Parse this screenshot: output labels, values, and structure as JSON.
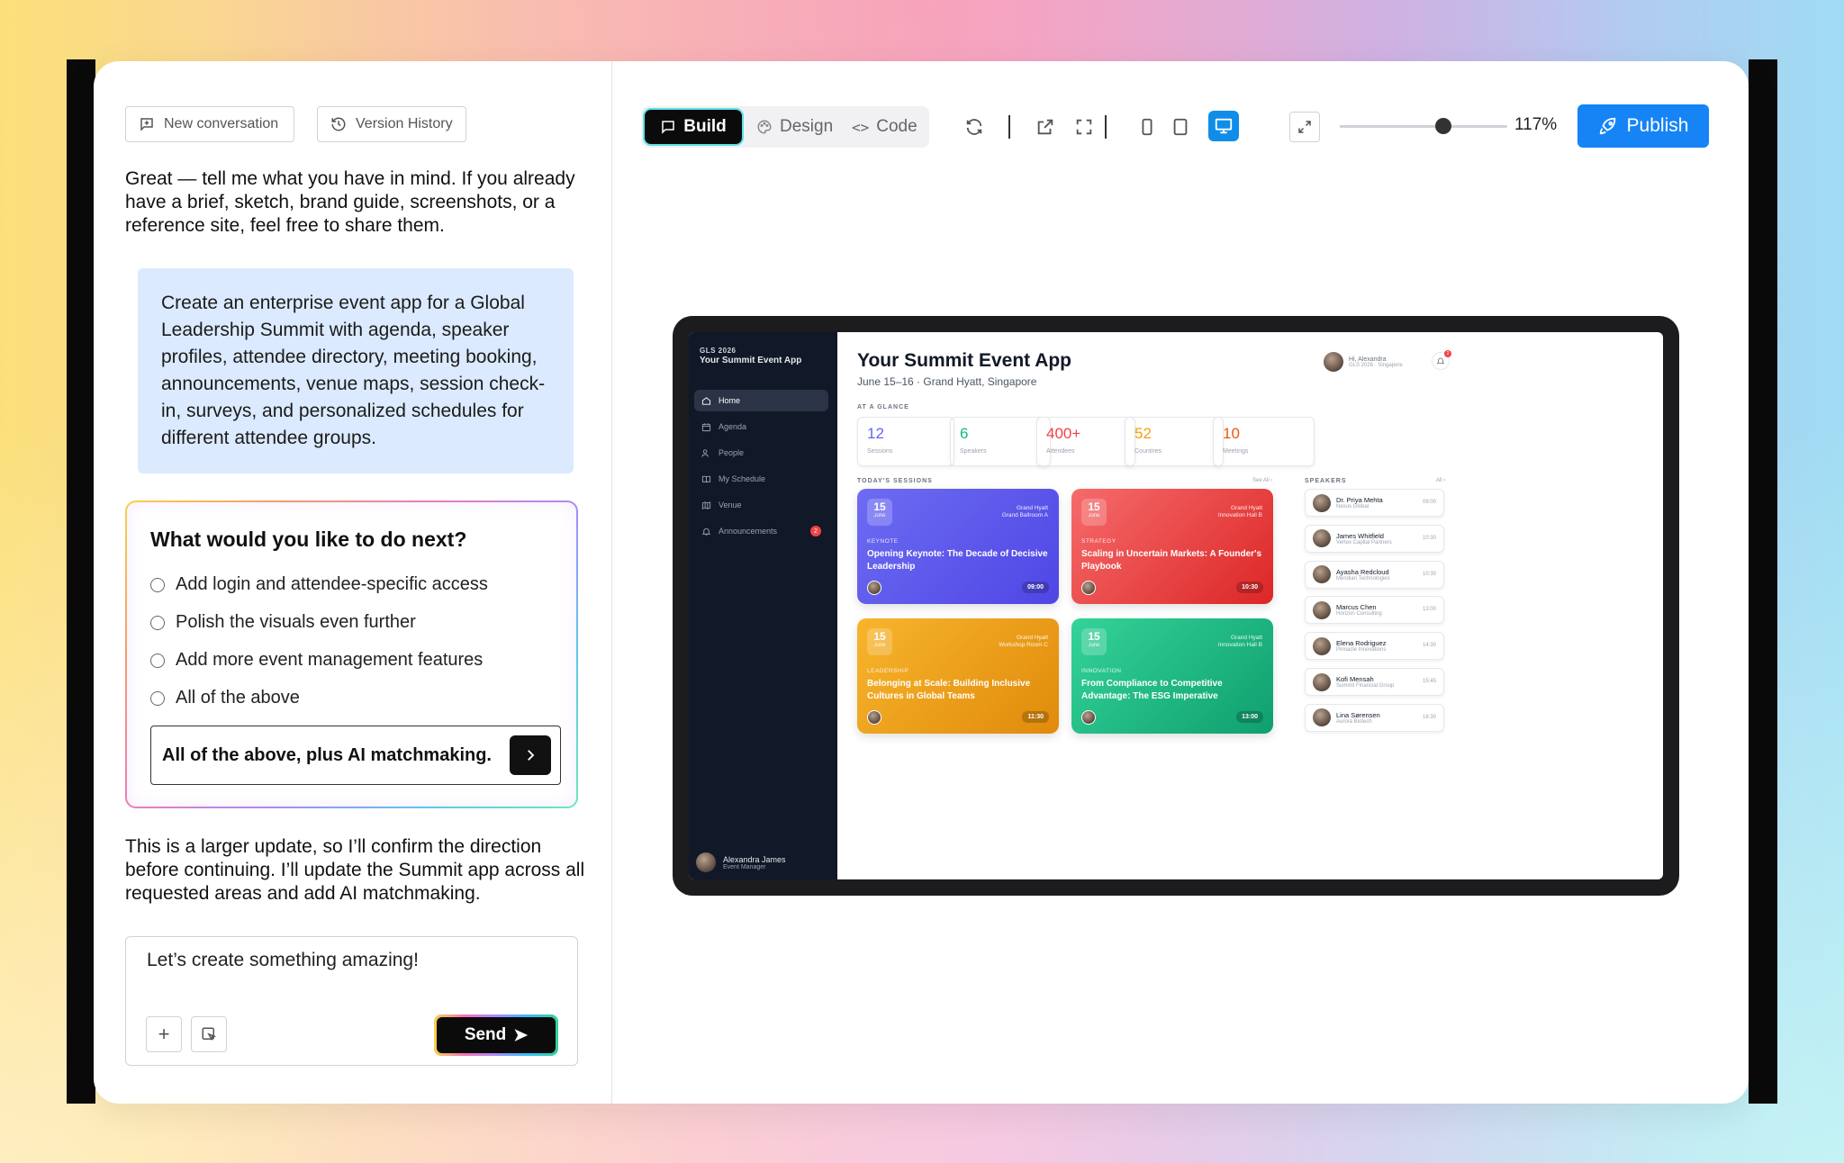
{
  "left_panel": {
    "new_conversation": "New conversation",
    "version_history": "Version History",
    "assistant_intro": "Great — tell me what you have in mind. If you already have a brief, sketch, brand guide, screenshots, or a reference site, feel free to share them.",
    "user_prompt": "Create an enterprise event app for a Global Leadership Summit with agenda, speaker profiles, attendee directory, meeting booking, announcements, venue maps, session check-in, surveys, and personalized schedules for different attendee groups.",
    "question": {
      "title": "What would you like to do next?",
      "options": [
        "Add login and attendee-specific access",
        "Polish the visuals even further",
        "Add more event management features",
        "All of the above"
      ],
      "answer": "All of the above, plus AI matchmaking."
    },
    "assistant_reply": "This is a larger update, so I’ll confirm the direction before continuing. I’ll update the Summit app across all requested areas and add AI matchmaking.",
    "composer": {
      "placeholder": "Let’s create something amazing!",
      "send": "Send"
    }
  },
  "toolbar": {
    "tabs": [
      "Build",
      "Design",
      "Code"
    ],
    "active_tab": "Build",
    "zoom": "117%",
    "zoom_level": 0.62,
    "publish": "Publish",
    "active_device": "desktop"
  },
  "preview": {
    "sidebar": {
      "kicker": "GLS 2026",
      "app_name": "Your Summit Event App",
      "nav": [
        {
          "label": "Home",
          "icon": "home-icon"
        },
        {
          "label": "Agenda",
          "icon": "calendar-icon"
        },
        {
          "label": "People",
          "icon": "people-icon"
        },
        {
          "label": "My Schedule",
          "icon": "book-icon"
        },
        {
          "label": "Venue",
          "icon": "map-icon"
        },
        {
          "label": "Announcements",
          "icon": "bell-icon",
          "badge": "2"
        }
      ],
      "active": "Home",
      "user": {
        "name": "Alexandra James",
        "role": "Event Manager"
      }
    },
    "header": {
      "title": "Your Summit Event App",
      "subtitle": "June 15–16 · Grand Hyatt, Singapore",
      "greeting": "Hi, Alexandra",
      "greeting_sub": "GLS 2026 · Singapore",
      "bell_badge": "2"
    },
    "glance_label": "AT A GLANCE",
    "stats": [
      {
        "value": "12",
        "label": "Sessions",
        "color": "#6366f1"
      },
      {
        "value": "6",
        "label": "Speakers",
        "color": "#10b981"
      },
      {
        "value": "400+",
        "label": "Attendees",
        "color": "#ef4444"
      },
      {
        "value": "52",
        "label": "Countries",
        "color": "#f59e0b"
      },
      {
        "value": "10",
        "label": "Meetings",
        "color": "#ea580c"
      }
    ],
    "sessions_label": "TODAY'S SESSIONS",
    "sessions_see_all": "See All ›",
    "sessions": [
      {
        "day": "15",
        "month": "June",
        "venue1": "Grand Hyatt",
        "venue2": "Grand Ballroom A",
        "category": "KEYNOTE",
        "title": "Opening Keynote: The Decade of Decisive Leadership",
        "time": "09:00",
        "color1": "#6d6cf2",
        "color2": "#4f46e5"
      },
      {
        "day": "15",
        "month": "June",
        "venue1": "Grand Hyatt",
        "venue2": "Innovation Hall B",
        "category": "STRATEGY",
        "title": "Scaling in Uncertain Markets: A Founder's Playbook",
        "time": "10:30",
        "color1": "#f66b6b",
        "color2": "#dc2626"
      },
      {
        "day": "15",
        "month": "June",
        "venue1": "Grand Hyatt",
        "venue2": "Workshop Room C",
        "category": "LEADERSHIP",
        "title": "Belonging at Scale: Building Inclusive Cultures in Global Teams",
        "time": "11:30",
        "color1": "#f7b52c",
        "color2": "#e08a0b"
      },
      {
        "day": "15",
        "month": "June",
        "venue1": "Grand Hyatt",
        "venue2": "Innovation Hall B",
        "category": "INNOVATION",
        "title": "From Compliance to Competitive Advantage: The ESG Imperative",
        "time": "13:00",
        "color1": "#34d399",
        "color2": "#0f9f6e"
      }
    ],
    "speakers_label": "SPEAKERS",
    "speakers_all": "All ›",
    "speakers": [
      {
        "name": "Dr. Priya Mehta",
        "org": "Nexus Global",
        "time": "09:00"
      },
      {
        "name": "James Whitfield",
        "org": "Vertex Capital Partners",
        "time": "10:30"
      },
      {
        "name": "Ayasha Redcloud",
        "org": "Meridian Technologies",
        "time": "10:30"
      },
      {
        "name": "Marcus Chen",
        "org": "Horizon Consulting",
        "time": "13:00"
      },
      {
        "name": "Elena Rodriguez",
        "org": "Pinnacle Innovations",
        "time": "14:30"
      },
      {
        "name": "Kofi Mensah",
        "org": "Summit Financial Group",
        "time": "15:45"
      },
      {
        "name": "Lina Sørensen",
        "org": "Aurora Biotech",
        "time": "16:30"
      }
    ]
  }
}
